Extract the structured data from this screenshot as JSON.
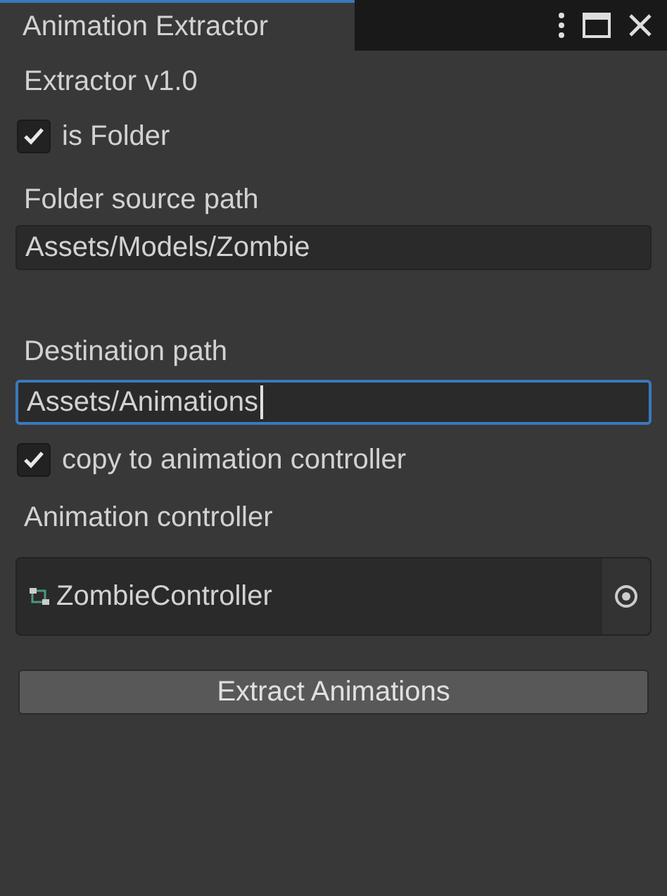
{
  "window": {
    "tab_title": "Animation Extractor"
  },
  "header": "Extractor v1.0",
  "is_folder": {
    "label": "is Folder",
    "checked": true
  },
  "source": {
    "label": "Folder source path",
    "value": "Assets/Models/Zombie",
    "focused": false
  },
  "destination": {
    "label": "Destination path",
    "value": "Assets/Animations",
    "focused": true
  },
  "copy_to_controller": {
    "label": "copy to animation controller",
    "checked": true
  },
  "controller": {
    "label": "Animation controller",
    "value": "ZombieController"
  },
  "button": "Extract Animations"
}
